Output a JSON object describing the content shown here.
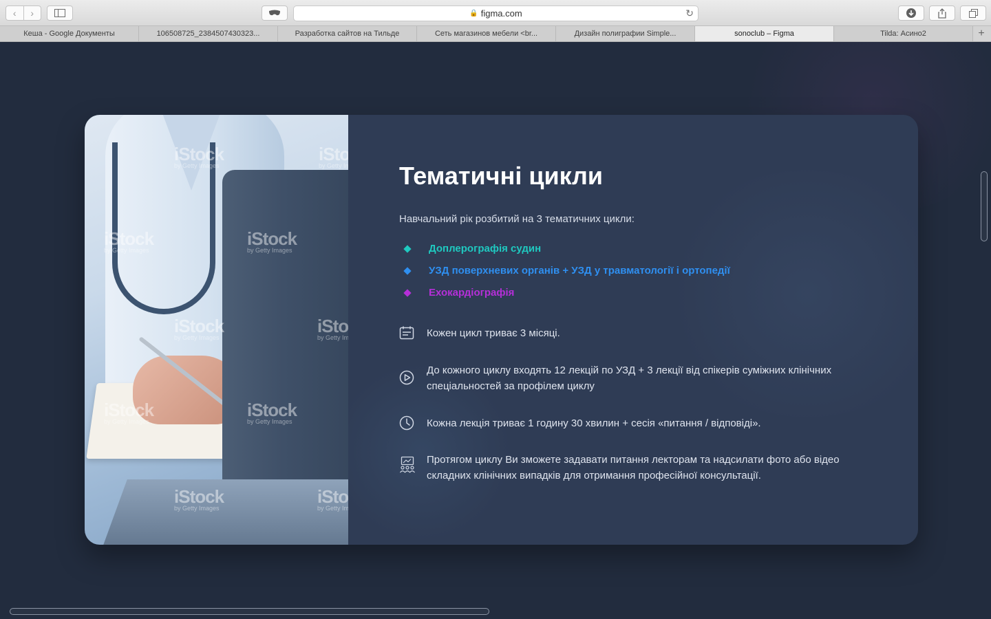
{
  "browser": {
    "url": "figma.com",
    "tabs": [
      {
        "label": "Кеша - Google Документы",
        "active": false
      },
      {
        "label": "106508725_2384507430323...",
        "active": false
      },
      {
        "label": "Разработка сайтов на Тильде",
        "active": false
      },
      {
        "label": "Сеть магазинов мебели <br...",
        "active": false
      },
      {
        "label": "Дизайн полиграфии Simple...",
        "active": false
      },
      {
        "label": "sonoclub – Figma",
        "active": true
      },
      {
        "label": "Tilda: Асино2",
        "active": false
      }
    ]
  },
  "section": {
    "title": "Тематичні цикли",
    "intro": "Навчальний рік розбитий на 3 тематичних цикли:",
    "cycles": [
      {
        "label": "Доплерографія судин",
        "color": "#1fc9c0"
      },
      {
        "label": "УЗД поверхневих органів + УЗД у травматології і ортопедії",
        "color": "#2f8ff0"
      },
      {
        "label": "Ехокардіографія",
        "color": "#b52fd8"
      }
    ],
    "features": [
      {
        "icon": "calendar-icon",
        "text": "Кожен цикл триває 3 місяці."
      },
      {
        "icon": "play-icon",
        "text": "До кожного циклу входять 12 лекцій по УЗД + 3 лекції від спікерів суміжних клінічних спеціальностей за профілем циклу"
      },
      {
        "icon": "clock-icon",
        "text": "Кожна лекція триває 1 годину 30 хвилин + сесія «питання / відповіді»."
      },
      {
        "icon": "presentation-group-icon",
        "text": "Протягом циклу Ви зможете задавати питання лекторам та надсилати фото або відео складних клінічних випадків для отримання професійної консультації."
      }
    ]
  },
  "photo": {
    "watermark": "iStock",
    "watermark_sub": "by Getty Images"
  }
}
